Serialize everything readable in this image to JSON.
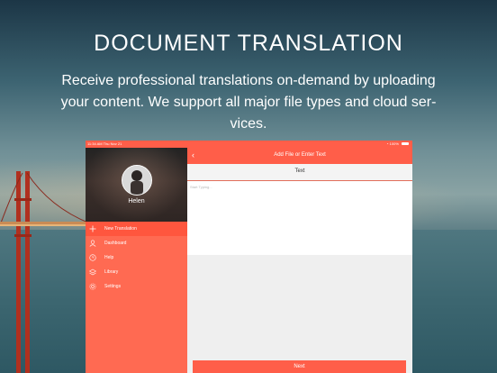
{
  "hero": {
    "title": "DOCUMENT TRANSLATION",
    "subtitle": "Receive professional translations on-demand by uploading your content. We support all major file types and cloud ser-vices."
  },
  "status_bar": {
    "time_date": "11:34 AM   Thu Nov 21",
    "battery": "100%"
  },
  "sidebar": {
    "username": "Helen",
    "items": [
      {
        "label": "New Translation",
        "icon": "plus-icon",
        "active": true
      },
      {
        "label": "Dashboard",
        "icon": "person-icon",
        "active": false
      },
      {
        "label": "Help",
        "icon": "clock-icon",
        "active": false
      },
      {
        "label": "Library",
        "icon": "layers-icon",
        "active": false
      },
      {
        "label": "Settings",
        "icon": "gear-icon",
        "active": false
      }
    ]
  },
  "nav": {
    "back_icon": "chevron-left-icon",
    "title": "Add File or Enter Text"
  },
  "segment": {
    "label": "Text"
  },
  "input": {
    "placeholder": "Start Typing..."
  },
  "actions": {
    "next_label": "Next"
  },
  "colors": {
    "accent": "#ff5e49",
    "sidebar": "#ff6a52"
  }
}
